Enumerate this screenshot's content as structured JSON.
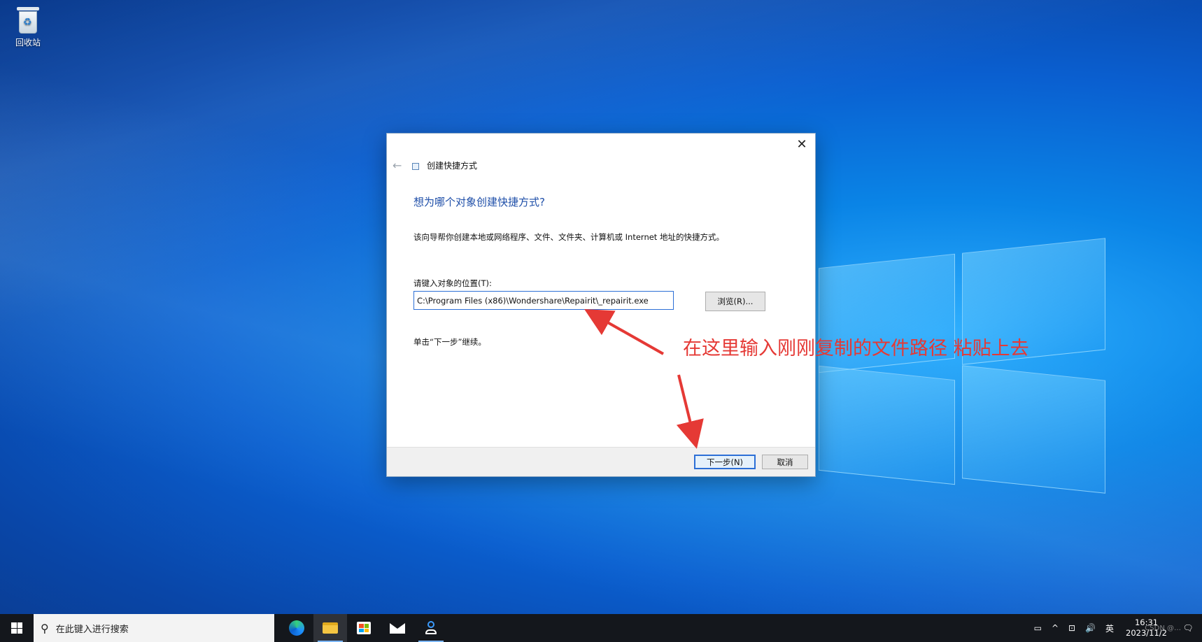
{
  "desktop": {
    "recycle_bin_label": "回收站"
  },
  "dialog": {
    "wizard_title": "创建快捷方式",
    "heading": "想为哪个对象创建快捷方式?",
    "description": "该向导帮你创建本地或网络程序、文件、文件夹、计算机或 Internet 地址的快捷方式。",
    "location_label": "请键入对象的位置(T):",
    "location_value": "C:\\Program Files (x86)\\Wondershare\\Repairit\\_repairit.exe",
    "browse_label": "浏览(R)...",
    "continue_hint": "单击“下一步”继续。",
    "next_label": "下一步(N)",
    "cancel_label": "取消",
    "close_glyph": "✕",
    "back_glyph": "←"
  },
  "annotation": {
    "text": "在这里输入刚刚复制的文件路径 粘贴上去",
    "color": "#e53935"
  },
  "taskbar": {
    "search_placeholder": "在此键入进行搜索",
    "apps": [
      "edge-icon",
      "file-explorer-icon",
      "store-icon",
      "mail-icon",
      "person-app-icon"
    ],
    "tray": {
      "news_glyph": "▭",
      "chevron_glyph": "^",
      "network_glyph": "⊡",
      "volume_glyph": "🔊",
      "ime": "英",
      "time": "16:31",
      "date": "2023/11/2",
      "notification_glyph": "🗨"
    }
  },
  "watermark": "CSDN @…"
}
